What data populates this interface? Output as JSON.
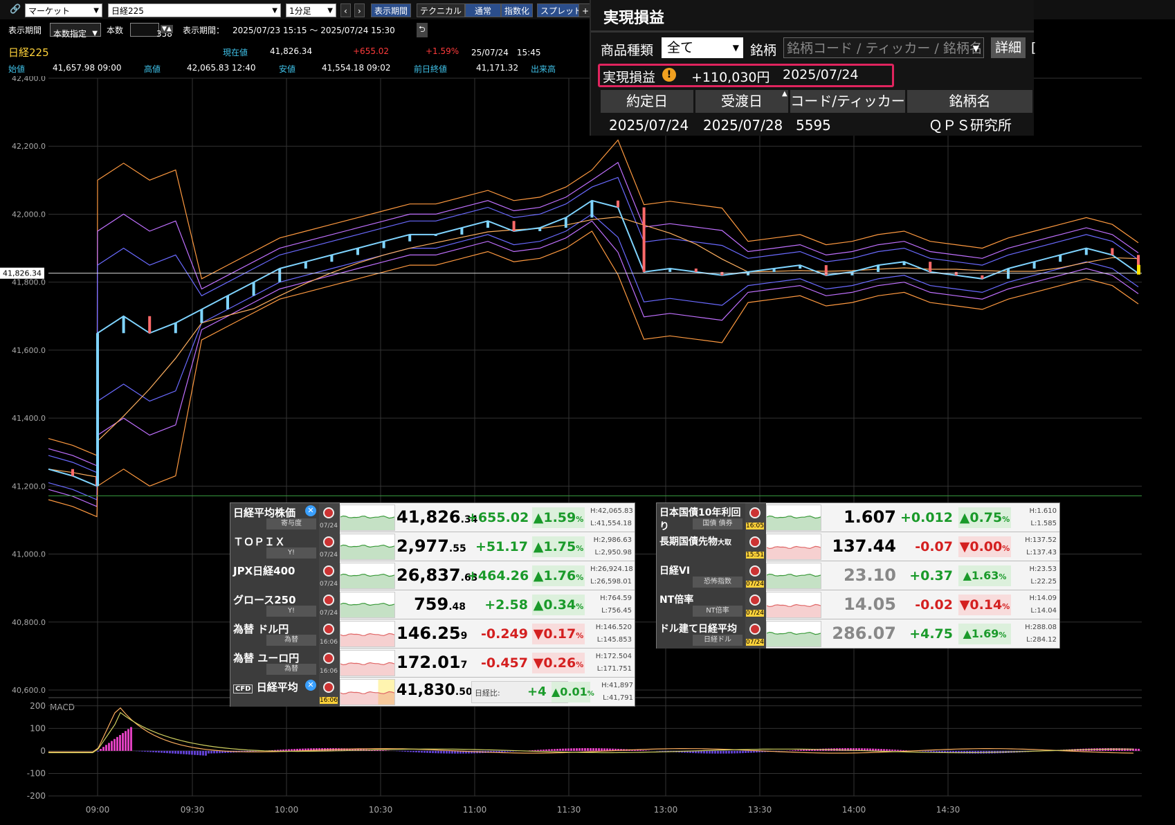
{
  "toolbar": {
    "market_select": "マーケット",
    "symbol_select": "日経225",
    "interval_select": "1分足",
    "btn_period": "表示期間",
    "btn_technical": "テクニカル",
    "btn_normal": "通常",
    "btn_index": "指数化",
    "btn_spread": "スプレッド",
    "btn_plus": "+"
  },
  "period_row": {
    "label_period": "表示期間",
    "mode_select": "本数指定",
    "label_count": "本数",
    "count_value": "358",
    "label_range": "表示期間：",
    "range_value": "2025/07/23 15:15 ～ 2025/07/24 15:30"
  },
  "quote_header": {
    "name": "日経225",
    "label_current": "現在値",
    "current": "41,826.34",
    "change": "+655.02",
    "change_pct": "+1.59%",
    "datetime": "25/07/24　15:45",
    "label_open": "始値",
    "open": "41,657.98 09:00",
    "label_high": "高値",
    "high": "42,065.83 12:40",
    "label_low": "安値",
    "low": "41,554.18 09:02",
    "label_prev": "前日終値",
    "prev": "41,171.32",
    "label_volume": "出来高"
  },
  "realized": {
    "title": "実現損益",
    "label_product": "商品種類",
    "product_select": "全て",
    "label_symbol": "銘柄",
    "symbol_placeholder": "銘柄コード / ティッカー / 銘柄名",
    "btn_detail": "詳細",
    "pnl_label": "実現損益",
    "pnl_value": "+110,030円",
    "pnl_date": "2025/07/24",
    "headers": [
      "約定日",
      "受渡日",
      "コード/ティッカー",
      "銘柄名"
    ],
    "row": [
      "2025/07/24",
      "2025/07/28",
      "5595",
      "ＱＰＳ研究所"
    ]
  },
  "chart_data": {
    "type": "line",
    "price_label": "41,826.34",
    "y_ticks": [
      "42,400.0",
      "42,200.0",
      "42,000.0",
      "41,800.0",
      "41,600.0",
      "41,400.0",
      "41,200.0",
      "41,000.0",
      "40,800.0",
      "40,600.0"
    ],
    "x_ticks": [
      "09:00",
      "09:30",
      "10:00",
      "10:30",
      "11:00",
      "11:30",
      "13:00",
      "13:30",
      "14:00",
      "14:30"
    ],
    "macd_label": "MACD",
    "macd_ticks": [
      "200",
      "100",
      "0",
      "-100",
      "-200"
    ],
    "price_series": [
      41250,
      41230,
      41200,
      41650,
      41700,
      41650,
      41680,
      41720,
      41760,
      41800,
      41840,
      41860,
      41880,
      41900,
      41920,
      41940,
      41940,
      41960,
      41980,
      41950,
      41960,
      41990,
      42040,
      42020,
      41830,
      41840,
      41830,
      41820,
      41830,
      41840,
      41850,
      41820,
      41830,
      41850,
      41860,
      41830,
      41820,
      41810,
      41840,
      41860,
      41880,
      41900,
      41880,
      41826
    ]
  },
  "quotes_left": [
    {
      "name": "日経平均株価",
      "sub": "寄与度",
      "date": "07/24",
      "price": "41,826",
      "price_dec": ".34",
      "chg": "+655.02",
      "pct": "▲1.59",
      "dir": "up",
      "hi": "H:42,065.83",
      "lo": "L:41,554.18",
      "x": true
    },
    {
      "name": "ＴＯＰＩＸ",
      "sub": "Y!",
      "date": "07/24",
      "price": "2,977",
      "price_dec": ".55",
      "chg": "+51.17",
      "pct": "▲1.75",
      "dir": "up",
      "hi": "H:2,986.63",
      "lo": "L:2,950.98"
    },
    {
      "name": "JPX日経400",
      "sub": "",
      "date": "07/24",
      "price": "26,837",
      "price_dec": ".63",
      "chg": "+464.26",
      "pct": "▲1.76",
      "dir": "up",
      "hi": "H:26,924.18",
      "lo": "L:26,598.01"
    },
    {
      "name": "グロース250",
      "sub": "Y!",
      "date": "07/24",
      "price": "759",
      "price_dec": ".48",
      "chg": "+2.58",
      "pct": "▲0.34",
      "dir": "up",
      "hi": "H:764.59",
      "lo": "L:756.45"
    },
    {
      "name": "為替 ドル円",
      "sub": "為替",
      "date": "16:06",
      "price": "146.25",
      "price_dec": "9",
      "chg": "-0.249",
      "pct": "▼0.17",
      "dir": "dn",
      "hi": "H:146.520",
      "lo": "L:145.853"
    },
    {
      "name": "為替 ユーロ円",
      "sub": "為替",
      "date": "16:06",
      "price": "172.01",
      "price_dec": "7",
      "chg": "-0.457",
      "pct": "▼0.26",
      "dir": "dn",
      "hi": "H:172.504",
      "lo": "L:171.751"
    }
  ],
  "cfd": {
    "name": "日経平均",
    "tag": "CFD",
    "date": "16:06",
    "price": "41,830",
    "price_dec": ".50",
    "label": "日経比:",
    "chg": "+4",
    "pct": "▲0.01",
    "hi": "H:41,897",
    "lo": "L:41,791"
  },
  "quotes_right": [
    {
      "name": "日本国債10年利回り",
      "sub": "国債 債券",
      "date": "16:05",
      "price": "1.607",
      "chg": "+0.012",
      "pct": "▲0.75",
      "dir": "up",
      "hi": "H:1.610",
      "lo": "L:1.585",
      "gray": false
    },
    {
      "name": "長期国債先物",
      "name_small": "大取",
      "sub": "",
      "date": "15:51",
      "price": "137.44",
      "chg": "-0.07",
      "pct": "▼0.00",
      "dir": "dn",
      "hi": "H:137.52",
      "lo": "L:137.43",
      "gray": false
    },
    {
      "name": "日経VI",
      "sub": "恐怖指数",
      "date": "07/24",
      "price": "23.10",
      "chg": "+0.37",
      "pct": "▲1.63",
      "dir": "up",
      "hi": "H:23.53",
      "lo": "L:22.25",
      "gray": true
    },
    {
      "name": "NT倍率",
      "sub": "NT倍率",
      "date": "07/24",
      "price": "14.05",
      "chg": "-0.02",
      "pct": "▼0.14",
      "dir": "dn",
      "hi": "H:14.09",
      "lo": "L:14.04",
      "gray": true
    },
    {
      "name": "ドル建て日経平均",
      "sub": "日経ドル",
      "date": "07/24",
      "price": "286.07",
      "chg": "+4.75",
      "pct": "▲1.69",
      "dir": "up",
      "hi": "H:288.08",
      "lo": "L:284.12",
      "gray": true
    }
  ]
}
